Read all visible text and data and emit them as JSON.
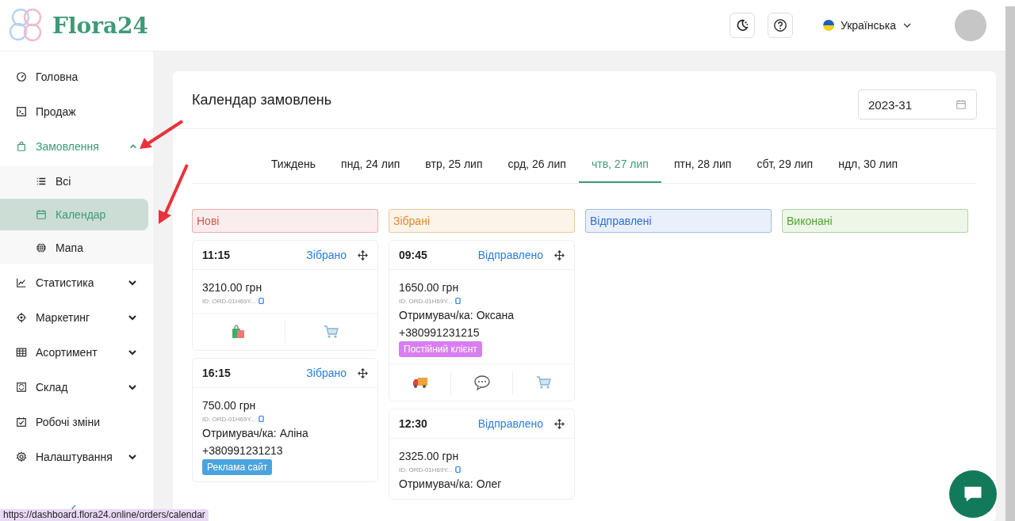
{
  "brand": "Flora24",
  "header": {
    "language": "Українська"
  },
  "sidebar": {
    "items": [
      {
        "label": "Головна",
        "selected": false
      },
      {
        "label": "Продаж",
        "selected": false
      },
      {
        "label": "Замовлення",
        "expanded": true,
        "selected": true,
        "children": [
          {
            "label": "Всі",
            "selected": false
          },
          {
            "label": "Календар",
            "selected": true
          },
          {
            "label": "Мапа",
            "selected": false
          }
        ]
      },
      {
        "label": "Статистика",
        "expanded": false,
        "selected": false
      },
      {
        "label": "Маркетинг",
        "expanded": false,
        "selected": false
      },
      {
        "label": "Асортимент",
        "expanded": false,
        "selected": false
      },
      {
        "label": "Склад",
        "expanded": false,
        "selected": false
      },
      {
        "label": "Робочі зміни",
        "selected": false
      },
      {
        "label": "Налаштування",
        "expanded": false,
        "selected": false
      }
    ]
  },
  "page": {
    "title": "Календар замовлень",
    "week_field": "2023-31"
  },
  "tabs": [
    {
      "label": "Тиждень",
      "selected": false
    },
    {
      "label": "пнд, 24 лип",
      "selected": false
    },
    {
      "label": "втр, 25 лип",
      "selected": false
    },
    {
      "label": "срд, 26 лип",
      "selected": false
    },
    {
      "label": "чтв, 27 лип",
      "selected": true
    },
    {
      "label": "птн, 28 лип",
      "selected": false
    },
    {
      "label": "сбт, 29 лип",
      "selected": false
    },
    {
      "label": "ндл, 30 лип",
      "selected": false
    }
  ],
  "columns": [
    {
      "title": "Нові",
      "color": "#d9534f",
      "orders": [
        {
          "time": "11:15",
          "status": "Зібрано",
          "amount": "3210.00 грн",
          "id": "ID: ORD-01H69Y...",
          "actions": [
            {
              "kind": "bag"
            },
            {
              "kind": "cart"
            }
          ]
        },
        {
          "time": "16:15",
          "status": "Зібрано",
          "amount": "750.00 грн",
          "id": "ID: ORD-01H69Y...",
          "recipient": "Отримувач/ка: Аліна",
          "phone": "+380991231213",
          "tag": {
            "label": "Реклама сайт",
            "color": "#4aa3df"
          }
        }
      ]
    },
    {
      "title": "Зібрані",
      "color": "#e08a2c",
      "orders": [
        {
          "time": "09:45",
          "status": "Відправлено",
          "amount": "1650.00 грн",
          "id": "ID: ORD-01H69Y...",
          "recipient": "Отримувач/ка: Оксана",
          "phone": "+380991231215",
          "tag": {
            "label": "Постійний клієнт",
            "color": "#d77ff0"
          },
          "actions": [
            {
              "kind": "truck"
            },
            {
              "kind": "chat"
            },
            {
              "kind": "cart"
            }
          ]
        },
        {
          "time": "12:30",
          "status": "Відправлено",
          "amount": "2325.00 грн",
          "id": "ID: ORD-01H69Y...",
          "recipient": "Отримувач/ка: Олег"
        }
      ]
    },
    {
      "title": "Відправлені",
      "color": "#2f6fd6"
    },
    {
      "title": "Виконані",
      "color": "#4fa62b"
    }
  ],
  "status_url": "https://dashboard.flora24.online/orders/calendar"
}
